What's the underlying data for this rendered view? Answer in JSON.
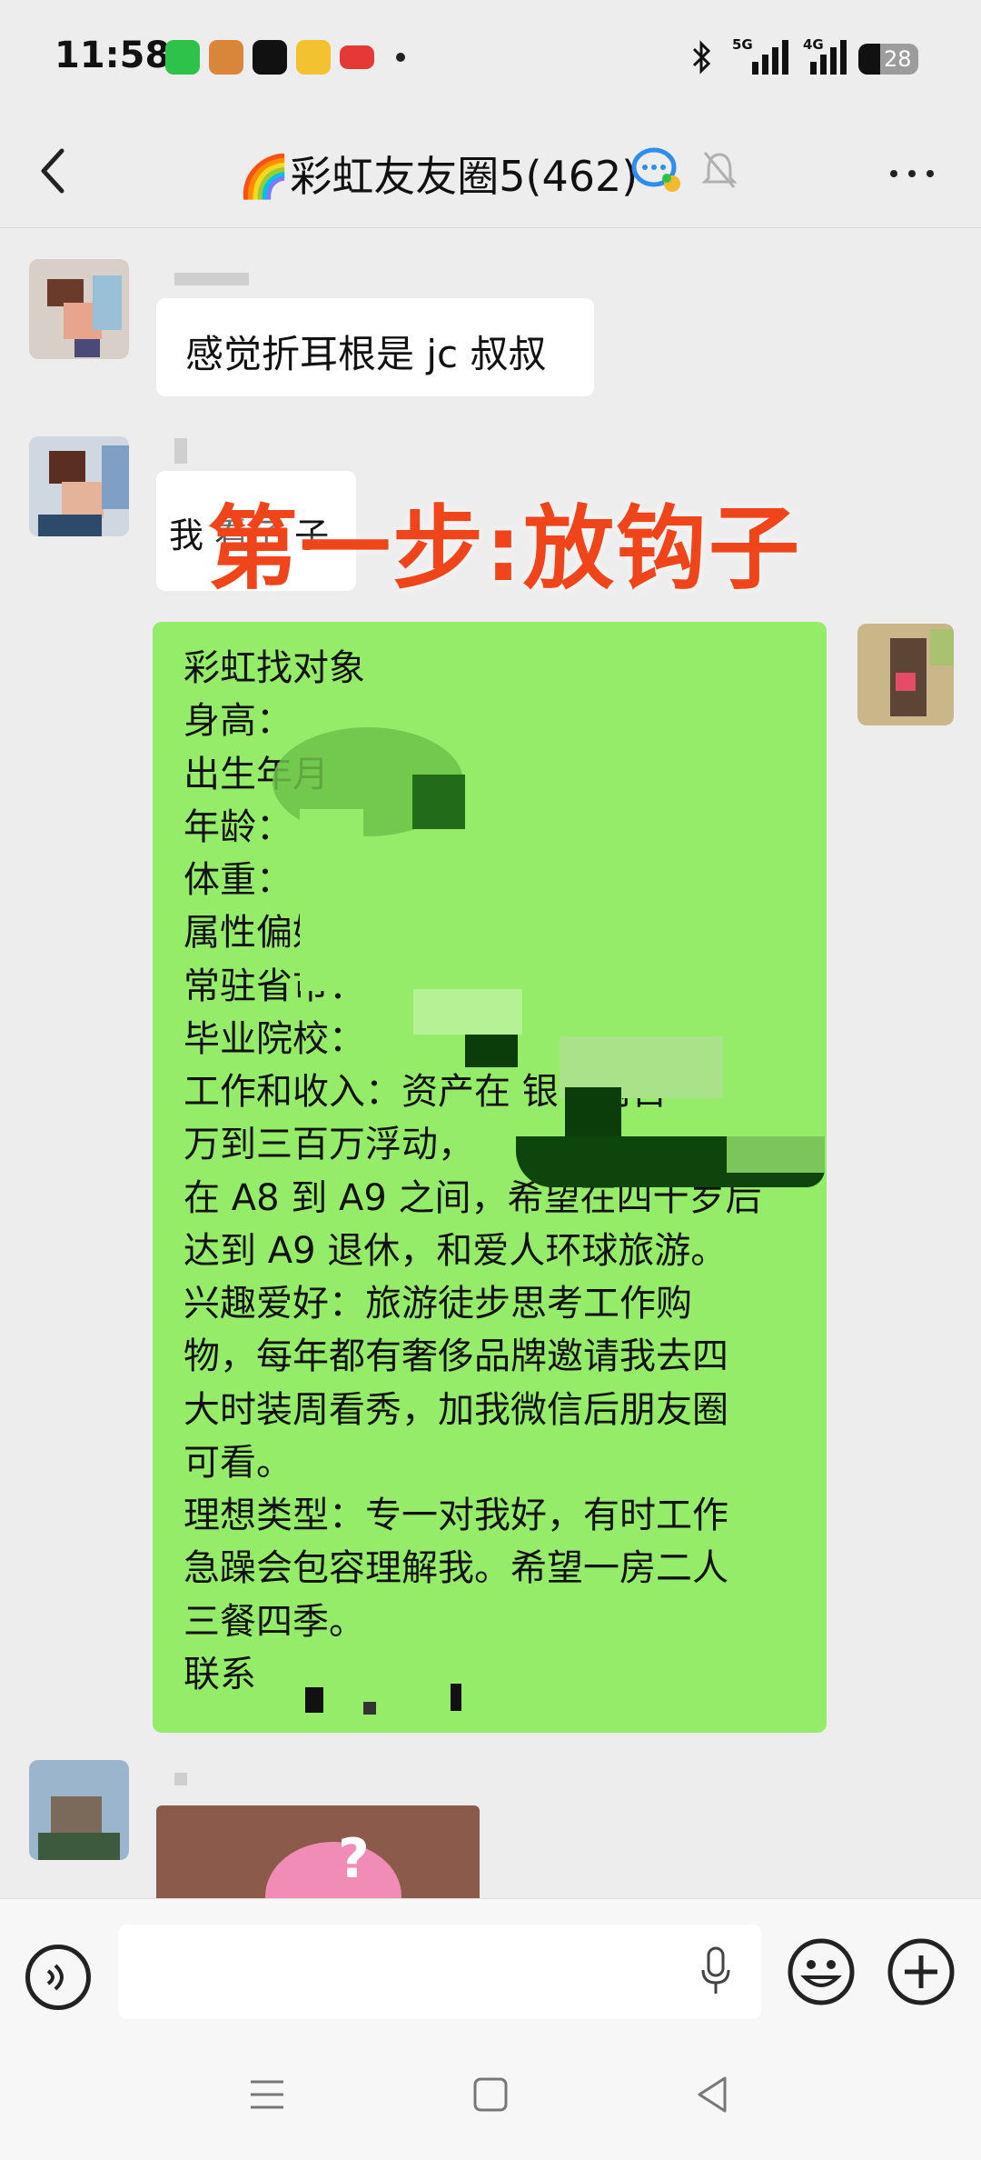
{
  "status_bar": {
    "time": "11:58",
    "network_1": "5G",
    "network_2": "4G",
    "battery": "28"
  },
  "header": {
    "title": "🌈彩虹友友圈5(462)",
    "back_icon": "chevron-left-icon",
    "more_icon": "more-dots-icon"
  },
  "messages": [
    {
      "type": "text",
      "side": "left",
      "text": "感觉折耳根是 jc 叔叔"
    },
    {
      "type": "text",
      "side": "left",
      "text": "我 看了 子"
    },
    {
      "type": "profile",
      "side": "right",
      "lines": [
        "彩虹找对象",
        "身高：",
        "出生年月",
        "年龄：",
        "体重：",
        "属性偏好",
        "常驻省市：",
        "毕业院校：",
        "工作和收入：资产在     银行两百",
        "万到三百万浮动，",
        "在 A8 到 A9 之间，希望在四十岁后",
        "达到 A9 退休，和爱人环球旅游。",
        "兴趣爱好：旅游徒步思考工作购",
        "物，每年都有奢侈品牌邀请我去四",
        "大时装周看秀，加我微信后朋友圈",
        "可看。",
        "理想类型：专一对我好，有时工作",
        "急躁会包容理解我。希望一房二人",
        "三餐四季。",
        "联系"
      ]
    },
    {
      "type": "image",
      "side": "left"
    }
  ],
  "overlay_caption": "第一步:放钩子",
  "input_bar": {
    "placeholder": "",
    "voice_icon": "voice-toggle-icon",
    "mic_icon": "microphone-icon",
    "emoji_icon": "emoji-icon",
    "plus_icon": "plus-icon"
  },
  "colors": {
    "background": "#ededed",
    "bubble_green": "#95ec69",
    "bubble_white": "#ffffff",
    "caption_red": "#f0441b"
  }
}
